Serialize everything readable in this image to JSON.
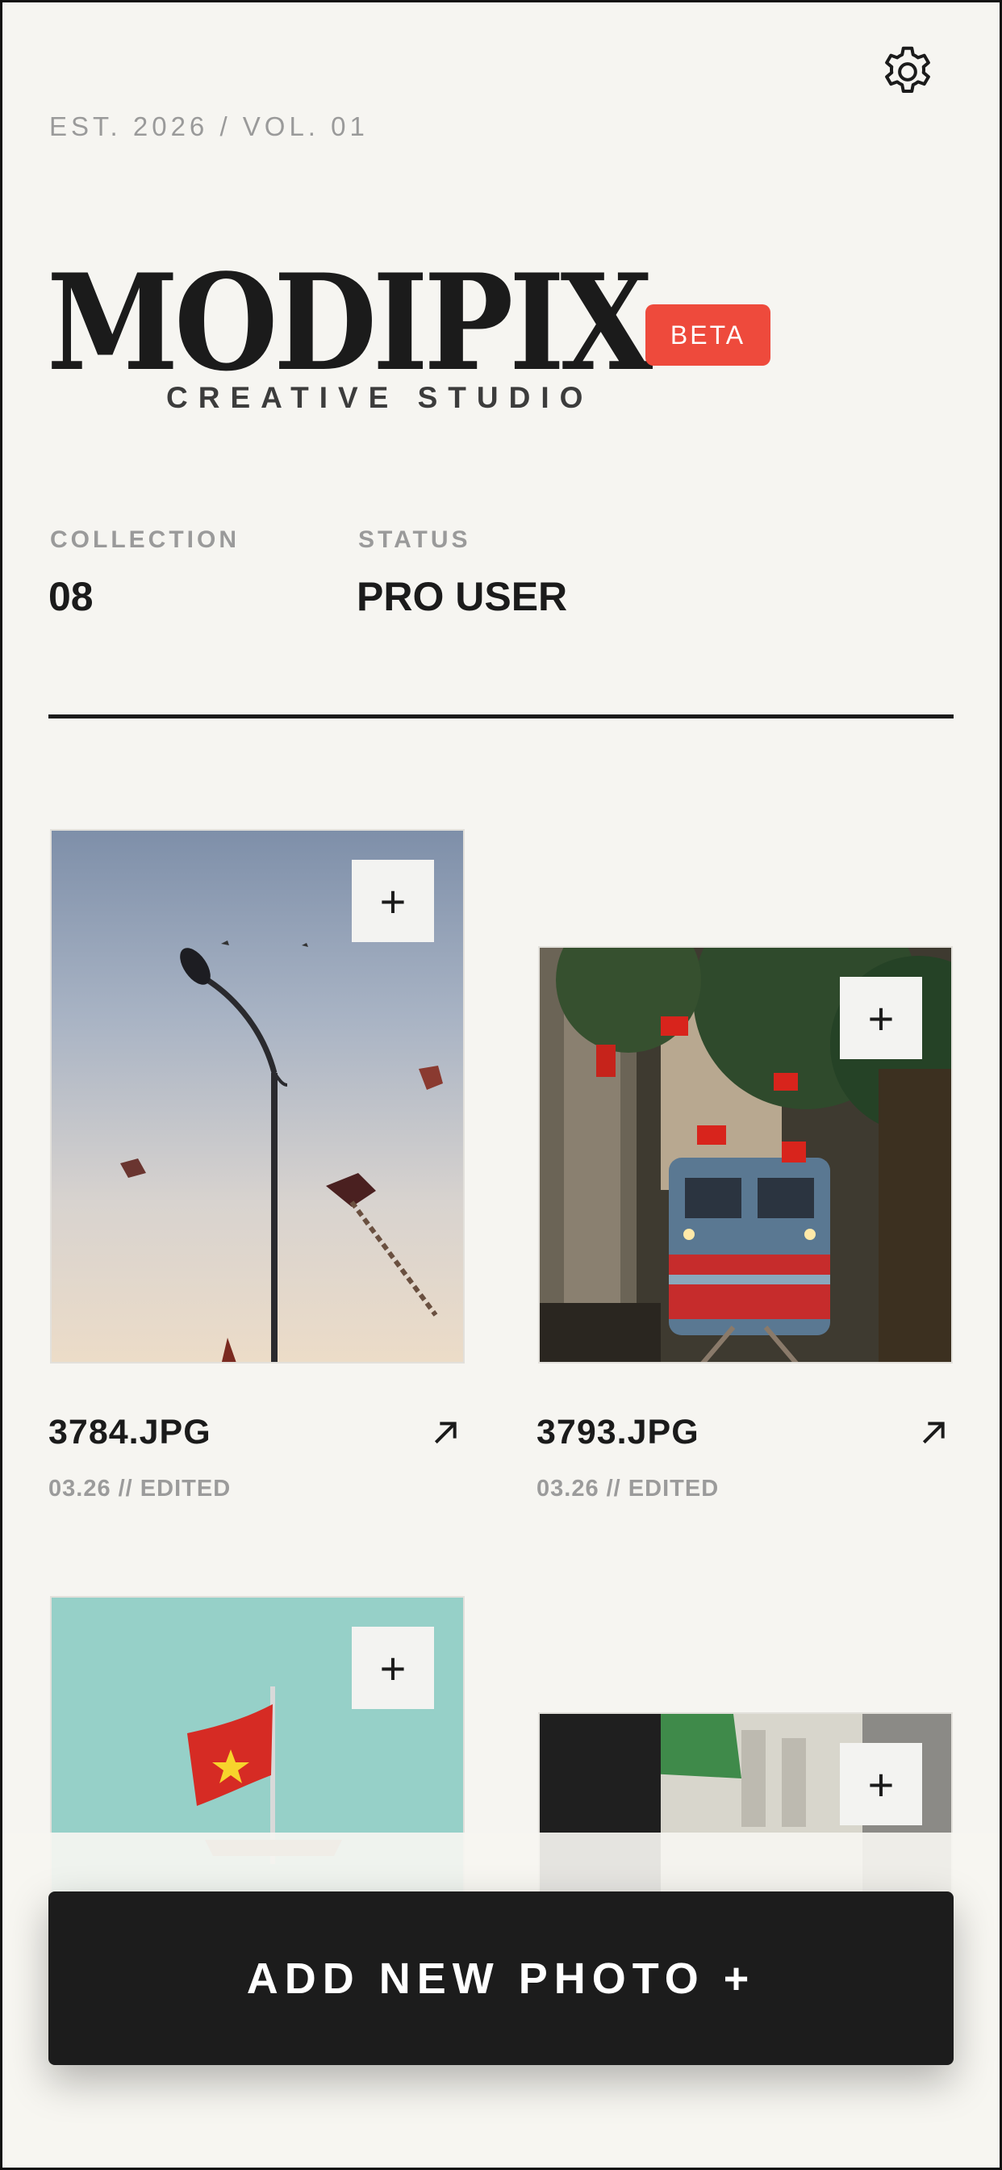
{
  "header": {
    "edition": "EST. 2026 / VOL. 01",
    "logo": "MODIPIX",
    "badge": "BETA",
    "subtitle": "CREATIVE STUDIO",
    "settings_icon": "gear-icon"
  },
  "stats": [
    {
      "label": "COLLECTION",
      "value": "08"
    },
    {
      "label": "STATUS",
      "value": "PRO USER"
    }
  ],
  "photos": [
    {
      "name": "3784.JPG",
      "meta": "03.26 // EDITED",
      "add_icon": "plus-icon",
      "open_icon": "arrow-up-right-icon"
    },
    {
      "name": "3793.JPG",
      "meta": "03.26 // EDITED",
      "add_icon": "plus-icon",
      "open_icon": "arrow-up-right-icon"
    },
    {
      "add_icon": "plus-icon"
    },
    {
      "add_icon": "plus-icon"
    }
  ],
  "cta": {
    "label": "ADD NEW PHOTO +"
  },
  "colors": {
    "background": "#f6f5f1",
    "accent": "#ee4a3c",
    "ink": "#1b1b1b"
  }
}
